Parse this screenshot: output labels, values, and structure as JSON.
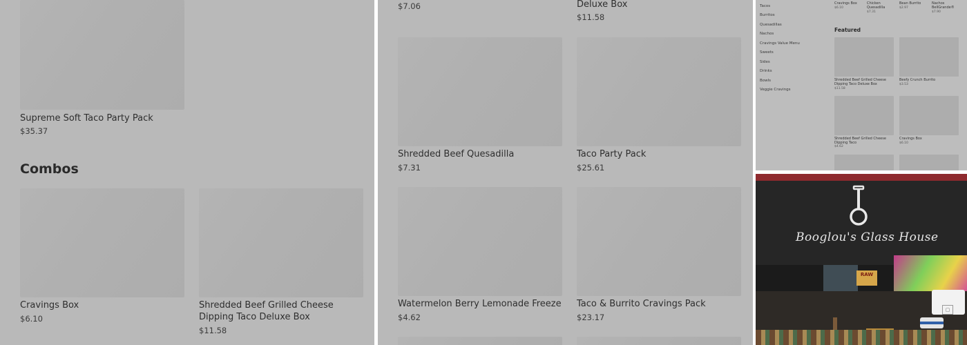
{
  "left_panel": {
    "top_item": {
      "name": "Supreme Soft Taco Party Pack",
      "price": "$35.37"
    },
    "section_title": "Combos",
    "combos": [
      {
        "name": "Cravings Box",
        "price": "$6.10"
      },
      {
        "name": "Shredded Beef Grilled Cheese Dipping Taco Deluxe Box",
        "price": "$11.58"
      }
    ]
  },
  "middle_panel": {
    "top_items": [
      {
        "name": "",
        "price": "$7.06"
      },
      {
        "name": "Deluxe Box",
        "price": "$11.58"
      }
    ],
    "items": [
      {
        "name": "Shredded Beef Quesadilla",
        "price": "$7.31"
      },
      {
        "name": "Taco Party Pack",
        "price": "$25.61"
      },
      {
        "name": "Watermelon Berry Lemonade Freeze",
        "price": "$4.62"
      },
      {
        "name": "Taco & Burrito Cravings Pack",
        "price": "$23.17"
      }
    ]
  },
  "small_panel": {
    "top_row": [
      {
        "name": "Cravings Box",
        "price": "$6.10"
      },
      {
        "name": "Chicken Quesadilla",
        "price": "$7.31"
      },
      {
        "name": "Bean Burrito",
        "price": "$2.97"
      },
      {
        "name": "Nachos BellGrande®",
        "price": "$7.90"
      }
    ],
    "categories": [
      "Tacos",
      "Burritos",
      "Quesadillas",
      "Nachos",
      "Cravings Value Menu",
      "Sweets",
      "Sides",
      "Drinks",
      "Bowls",
      "Veggie Cravings"
    ],
    "featured_title": "Featured",
    "featured": [
      {
        "name": "Shredded Beef Grilled Cheese Dipping Taco Deluxe Box",
        "price": "$11.58"
      },
      {
        "name": "Beefy Crunch Burrito",
        "price": "$3.53"
      },
      {
        "name": "Shredded Beef Grilled Cheese Dipping Taco",
        "price": "$4.62"
      },
      {
        "name": "Cravings Box",
        "price": "$6.10"
      }
    ]
  },
  "photo_panel": {
    "banner_text": "Booglou's Glass House",
    "box_label": "RAW",
    "terminal_icon": "square-icon"
  }
}
